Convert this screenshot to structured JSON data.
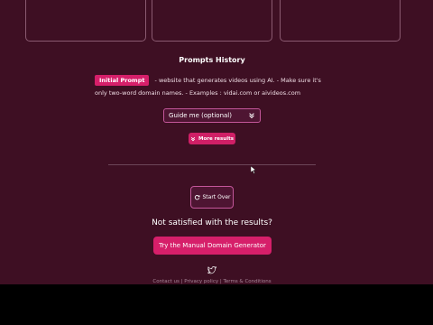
{
  "prompts_history": {
    "title": "Prompts History",
    "badge": "Initial Prompt",
    "text": "- website that generates videos using AI. - Make sure it's only two-word domain names. - Examples : vidai.com or aivideos.com"
  },
  "guide_button": {
    "label": "Guide me (optional)",
    "icon": "chevrons-down-icon"
  },
  "more_results_button": {
    "label": "More results",
    "icon": "chevrons-down-icon"
  },
  "start_over_button": {
    "label": "Start Over",
    "icon": "refresh-icon"
  },
  "not_satisfied": "Not satisfied with the results?",
  "manual_generator_button": {
    "label": "Try the Manual Domain Generator"
  },
  "footer": {
    "contact": "Contact us",
    "privacy": "Privacy policy",
    "terms": "Terms & Conditions",
    "separator": "|"
  },
  "colors": {
    "background": "#3e0f23",
    "accent": "#d61f6a",
    "border": "#c3569a"
  }
}
